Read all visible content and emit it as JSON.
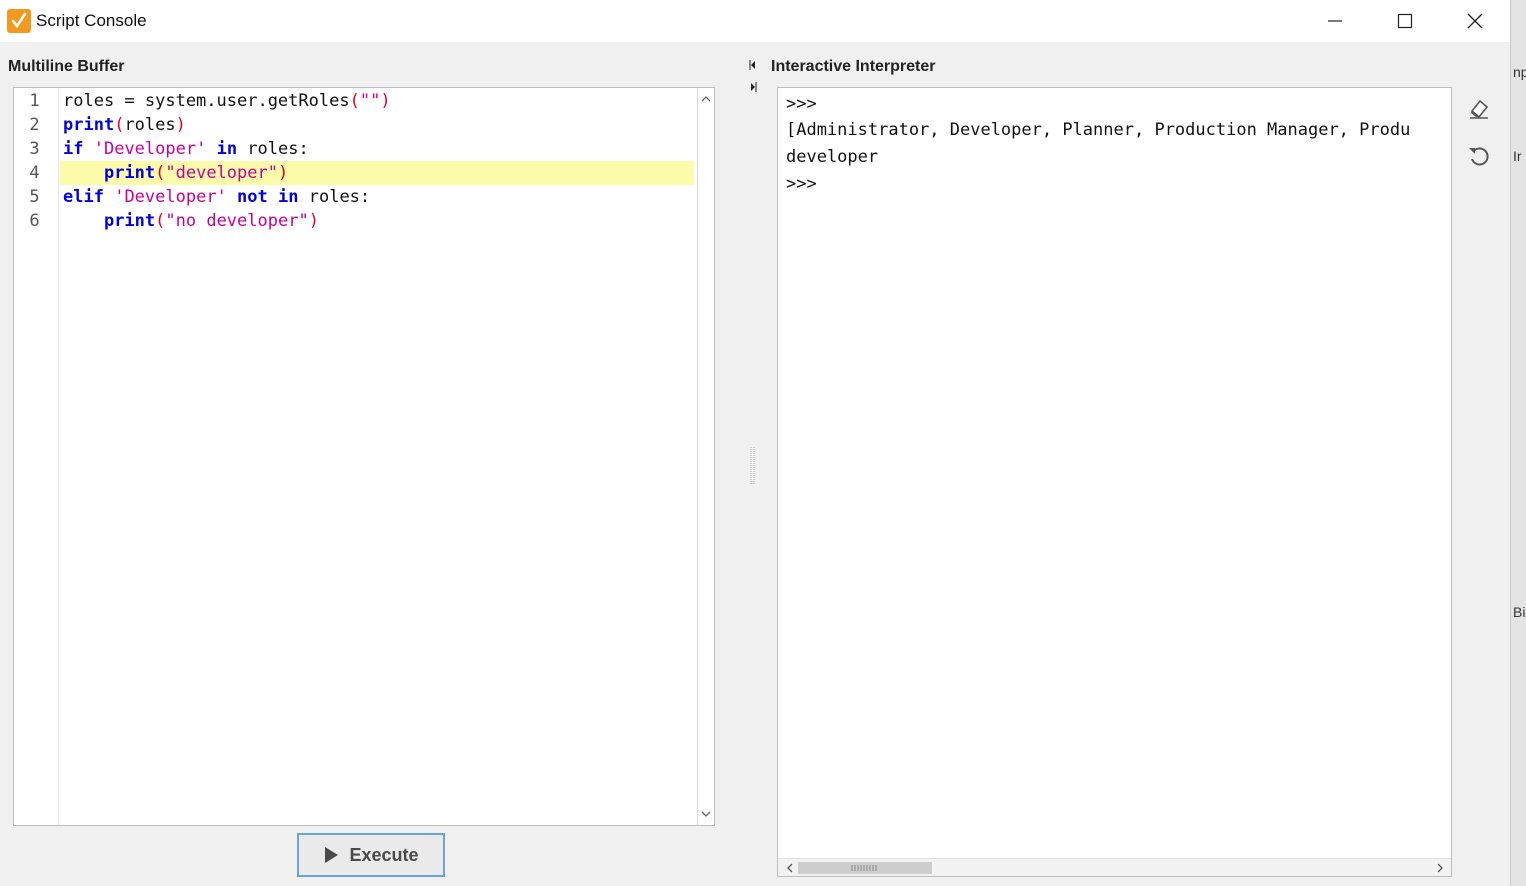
{
  "window": {
    "title": "Script Console",
    "controls": {
      "minimize": "—",
      "maximize": "☐",
      "close": "✕"
    }
  },
  "left_panel": {
    "title": "Multiline Buffer",
    "line_numbers": [
      "1",
      "2",
      "3",
      "4",
      "5",
      "6"
    ],
    "current_line": 4,
    "code_lines": [
      "roles = system.user.getRoles(\"\")",
      "print(roles)",
      "if 'Developer' in roles:",
      "    print(\"developer\")",
      "elif 'Developer' not in roles:",
      "    print(\"no developer\")"
    ],
    "execute_label": "Execute"
  },
  "right_panel": {
    "title": "Interactive Interpreter",
    "output_lines": [
      ">>>",
      "[Administrator, Developer, Planner, Production Manager, Produ",
      "developer",
      ">>>"
    ]
  },
  "colors": {
    "keyword": "#0000e0",
    "string": "#c8009a",
    "paren": "#e0002a",
    "highlight_line": "#fbfbaa",
    "execute_border": "#6da4d6",
    "app_icon": "#f29a1f"
  },
  "icons": {
    "app": "script-console-icon",
    "clear": "eraser-icon",
    "reset": "reset-icon",
    "run": "play-icon"
  },
  "right_edge_fragments": [
    "np",
    "Ir",
    "Bi"
  ]
}
